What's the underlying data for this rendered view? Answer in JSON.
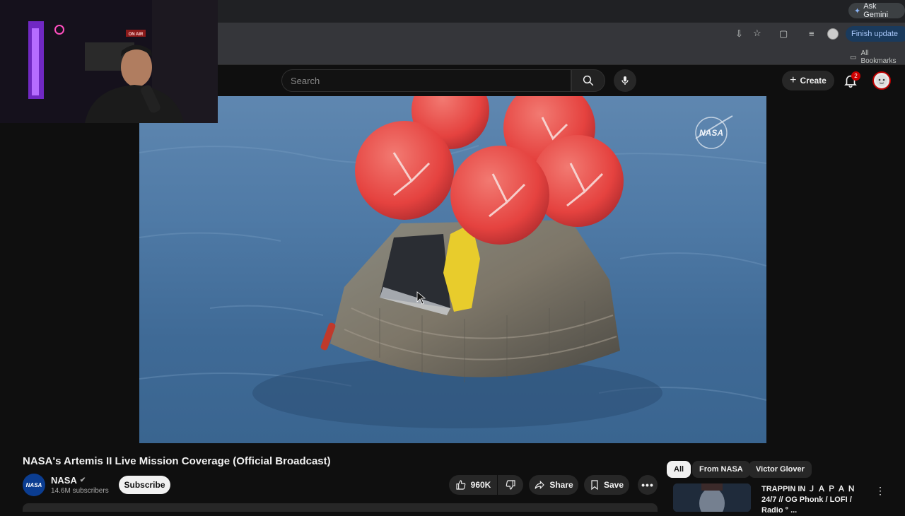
{
  "browser": {
    "ask_gemini": "Ask Gemini",
    "url_fragment": "s",
    "finish_update": "Finish update",
    "all_bookmarks": "All Bookmarks"
  },
  "webcam": {
    "on_air": "ON AIR"
  },
  "header": {
    "search_placeholder": "Search",
    "create_label": "Create",
    "notification_count": "2"
  },
  "video": {
    "watermark": "NASA"
  },
  "watch": {
    "title": "NASA's Artemis II Live Mission Coverage (Official Broadcast)",
    "channel_logo": "NASA",
    "channel_name": "NASA",
    "subscribers": "14.6M subscribers",
    "subscribe_label": "Subscribe",
    "like_count": "960K",
    "share_label": "Share",
    "save_label": "Save"
  },
  "sidebar": {
    "chips": [
      "All",
      "From NASA",
      "Victor Glover"
    ],
    "recommendation_title": "TRAPPIN IN Ｊ Ａ Ｐ Ａ Ｎ 24/7 // OG Phonk / LOFI / Radio ° ..."
  },
  "colors": {
    "background": "#0f0f0f",
    "accent_red": "#cc0000",
    "ocean": "#4f7aa6",
    "balloon": "#e8494a"
  }
}
